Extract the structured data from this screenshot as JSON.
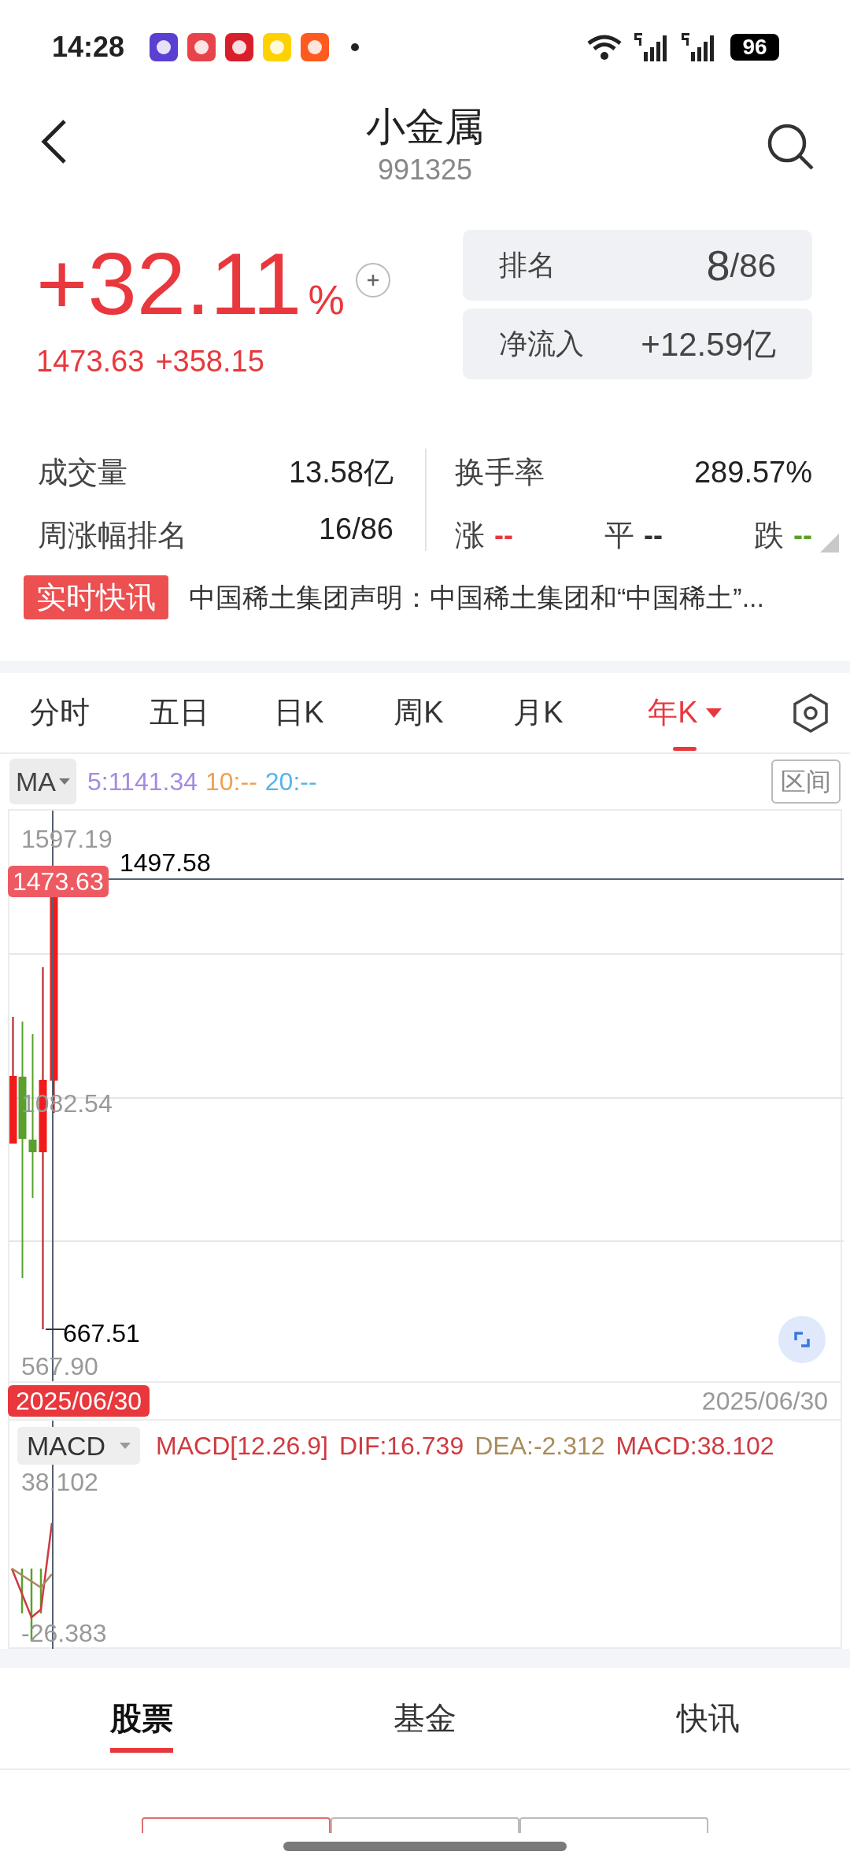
{
  "status_bar": {
    "time": "14:28",
    "app_icons": [
      {
        "color": "#5a3fd1"
      },
      {
        "color": "#e8434b"
      },
      {
        "color": "#d81e2a"
      },
      {
        "color": "#ffd100"
      },
      {
        "color": "#ff5a1f"
      }
    ],
    "battery": "96"
  },
  "header": {
    "title": "小金属",
    "code": "991325"
  },
  "quote": {
    "change_percent": "+32.11",
    "percent_sign": "%",
    "price": "1473.63",
    "change": "+358.15"
  },
  "rank_box": {
    "label": "排名",
    "rank": "8",
    "total": "/86"
  },
  "inflow_box": {
    "label": "净流入",
    "value": "+12.59亿"
  },
  "stats": [
    {
      "label": "成交量",
      "value": "13.58亿"
    },
    {
      "label": "换手率",
      "value": "289.57%"
    },
    {
      "label": "周涨幅排名",
      "value": "16/86"
    }
  ],
  "breadth": [
    {
      "label": "涨",
      "value": "--",
      "color": "#e8383d"
    },
    {
      "label": "平",
      "value": "--",
      "color": "#333333"
    },
    {
      "label": "跌",
      "value": "--",
      "color": "#5aa02c"
    }
  ],
  "news": {
    "badge": "实时快讯",
    "headline": "中国稀土集团声明：中国稀土集团和“中国稀土”..."
  },
  "period_tabs": [
    {
      "label": "分时",
      "selected": false
    },
    {
      "label": "五日",
      "selected": false
    },
    {
      "label": "日K",
      "selected": false
    },
    {
      "label": "周K",
      "selected": false
    },
    {
      "label": "月K",
      "selected": false
    },
    {
      "label": "年K",
      "selected": true
    }
  ],
  "indicator": {
    "name": "MA",
    "values": [
      {
        "text": "5:1141.34",
        "color": "#a48be0"
      },
      {
        "text": "10:--",
        "color": "#f0a050"
      },
      {
        "text": "20:--",
        "color": "#56b4e9"
      }
    ],
    "range_button": "区间"
  },
  "kline": {
    "axis_labels": [
      "1597.19",
      "1082.54",
      "567.90"
    ],
    "high_label": "1497.58",
    "low_label": "667.51",
    "price_tag": "1473.63",
    "date_tag": "2025/06/30",
    "end_date": "2025/06/30"
  },
  "macd": {
    "name": "MACD",
    "params": "MACD[12.26.9]",
    "values": [
      {
        "text": "DIF:16.739",
        "color": "#d0393f"
      },
      {
        "text": "DEA:-2.312",
        "color": "#a88c5c"
      },
      {
        "text": "MACD:38.102",
        "color": "#d0393f"
      }
    ],
    "axis_labels": [
      "38.102",
      "-26.383"
    ]
  },
  "bottom_tabs": [
    {
      "label": "股票",
      "selected": true
    },
    {
      "label": "基金",
      "selected": false
    },
    {
      "label": "快讯",
      "selected": false
    }
  ],
  "segments": [
    {
      "selected": true
    },
    {
      "selected": false
    },
    {
      "selected": false
    }
  ]
}
